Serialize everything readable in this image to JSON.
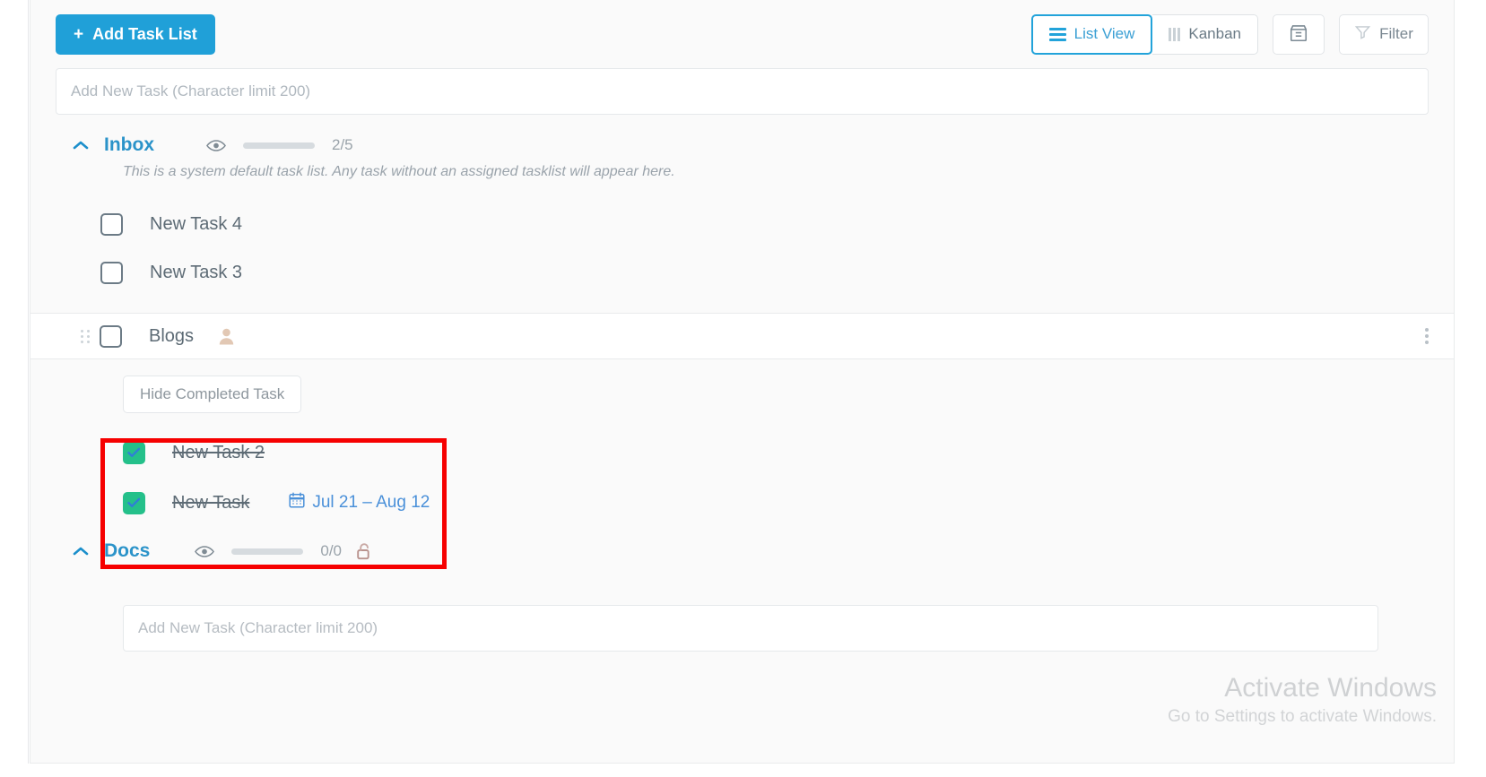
{
  "toolbar": {
    "add_task_list_label": "Add Task List",
    "add_plus": "+",
    "list_view_label": "List View",
    "kanban_label": "Kanban",
    "filter_label": "Filter",
    "archive_icon": "archive-box-icon",
    "filter_icon": "funnel-icon",
    "hamburger_icon": "list-lines-icon",
    "kanban_icon": "kanban-columns-icon",
    "active_view": "List View",
    "accent_color": "#20a0d8"
  },
  "top_task_input": {
    "placeholder": "Add New Task (Character limit 200)",
    "value": ""
  },
  "sections": [
    {
      "title": "Inbox",
      "chevron": "chevron-up-icon",
      "eye_icon": "eye-icon",
      "progress_percent": 40,
      "progress_count": "2/5",
      "description": "This is a system default task list. Any task without an assigned tasklist will appear here.",
      "has_lock": false
    },
    {
      "title": "Docs",
      "chevron": "chevron-up-icon",
      "eye_icon": "eye-icon",
      "progress_percent": 0,
      "progress_count": "0/0",
      "description": "",
      "has_lock": true,
      "lock_icon": "unlock-icon"
    }
  ],
  "tasks": {
    "inbox": [
      {
        "label": "New Task 4",
        "checked": false
      },
      {
        "label": "New Task 3",
        "checked": false
      }
    ],
    "highlighted_row": {
      "label": "Blogs",
      "checked": false,
      "drag_handle": "drag-dots-icon",
      "avatar": "user-avatar-icon",
      "menu": "more-vertical-icon"
    },
    "completed": [
      {
        "label": "New Task 2",
        "checked": true,
        "date": ""
      },
      {
        "label": "New Task",
        "checked": true,
        "date": "Jul 21 – Aug 12",
        "date_icon": "calendar-icon"
      }
    ]
  },
  "hide_completed": {
    "label": "Hide Completed Task"
  },
  "bottom_task_input": {
    "placeholder": "Add New Task (Character limit 200)",
    "value": ""
  },
  "highlight": {
    "color": "#f60000"
  },
  "watermark": {
    "title": "Activate Windows",
    "subtitle": "Go to Settings to activate Windows."
  }
}
